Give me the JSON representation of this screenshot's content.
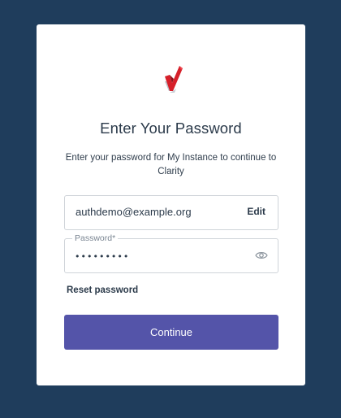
{
  "login": {
    "title": "Enter Your Password",
    "subtitle": "Enter your password for My Instance to continue to Clarity",
    "email": "authdemo@example.org",
    "edit_label": "Edit",
    "password_label": "Password*",
    "password_value": "•••••••••",
    "reset_label": "Reset password",
    "continue_label": "Continue"
  },
  "icons": {
    "logo": "checkmark-logo-icon",
    "show_password": "eye-icon"
  },
  "colors": {
    "background": "#1f3d5c",
    "card": "#ffffff",
    "primary_button": "#5454a9",
    "logo_red": "#d6202a",
    "text": "#2b3a4a"
  }
}
